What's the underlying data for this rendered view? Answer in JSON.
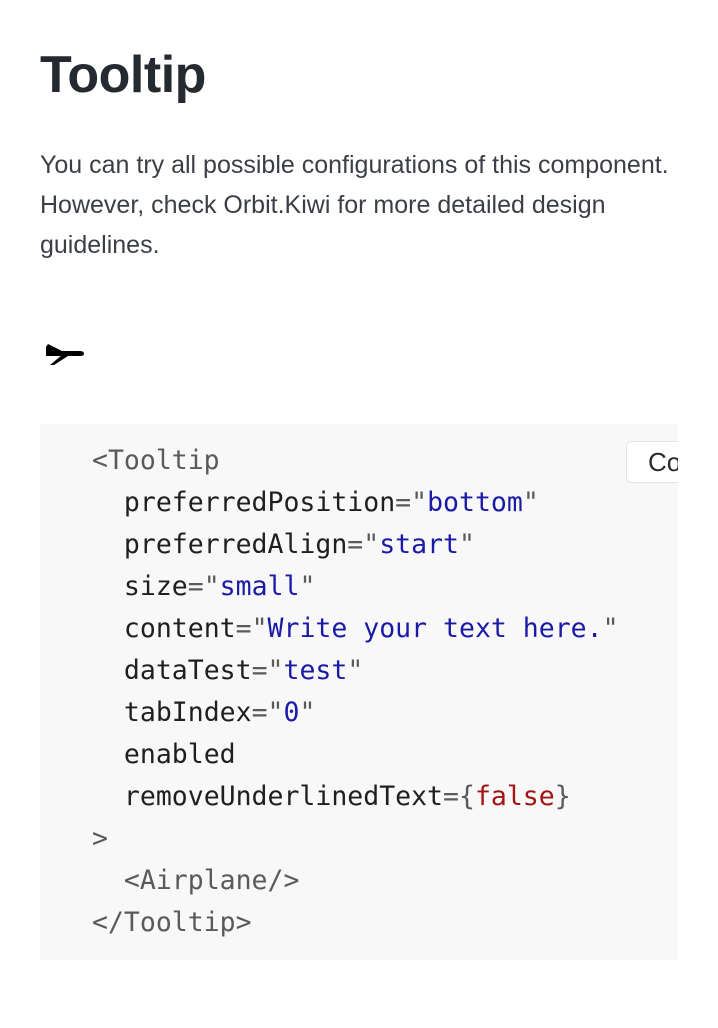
{
  "page": {
    "title": "Tooltip",
    "intro": "You can try all possible configurations of this component. However, check Orbit.Kiwi for more detailed design guidelines."
  },
  "preview": {
    "icon": "airplane-icon"
  },
  "code": {
    "copy_label": "Copy",
    "open_tag": "<Tooltip",
    "props": [
      {
        "name": "preferredPosition",
        "eq": "=\"",
        "value": "bottom",
        "close": "\""
      },
      {
        "name": "preferredAlign",
        "eq": "=\"",
        "value": "start",
        "close": "\""
      },
      {
        "name": "size",
        "eq": "=\"",
        "value": "small",
        "close": "\""
      },
      {
        "name": "content",
        "eq": "=\"",
        "value": "Write your text here.",
        "close": "\""
      },
      {
        "name": "dataTest",
        "eq": "=\"",
        "value": "test",
        "close": "\""
      },
      {
        "name": "tabIndex",
        "eq": "=\"",
        "value": "0",
        "close": "\""
      },
      {
        "name": "enabled"
      },
      {
        "name": "removeUnderlinedText",
        "eq": "={",
        "value": "false",
        "close": "}"
      }
    ],
    "open_tag_end": ">",
    "child": "<Airplane/>",
    "close_tag": "</Tooltip>"
  },
  "colors": {
    "string": "#1a1aa6",
    "keyword": "#a31515",
    "panel_bg": "#f8f8f8"
  }
}
